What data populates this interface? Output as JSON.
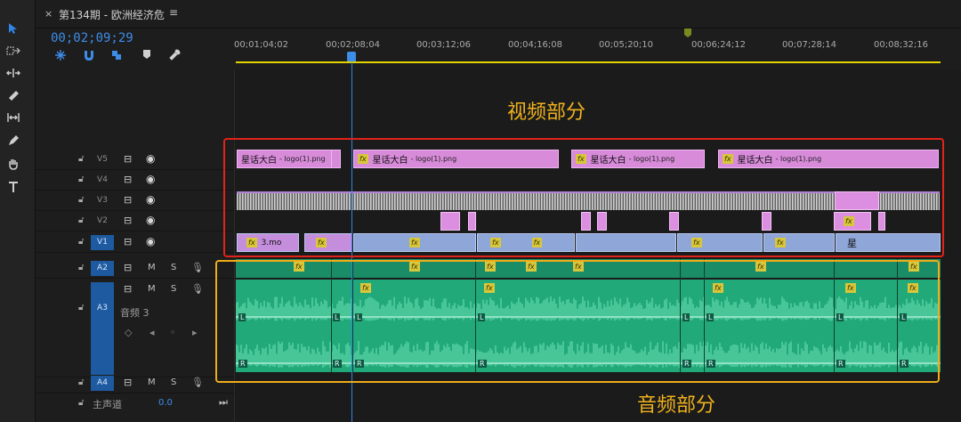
{
  "panel": {
    "close_glyph": "×",
    "sequence_title": "第134期 - 欧洲经济危",
    "menu_glyph": "≡",
    "timecode": "00;02;09;29"
  },
  "ruler": {
    "ticks": [
      "00;01;04;02",
      "00;02;08;04",
      "00;03;12;06",
      "00;04;16;08",
      "00;05;20;10",
      "00;06;24;12",
      "00;07;28;14",
      "00;08;32;16"
    ]
  },
  "annotations": {
    "video": "视频部分",
    "audio": "音频部分"
  },
  "tracks": {
    "video": [
      {
        "name": "V5",
        "target": false
      },
      {
        "name": "V4",
        "target": false
      },
      {
        "name": "V3",
        "target": false
      },
      {
        "name": "V2",
        "target": false
      },
      {
        "name": "V1",
        "target": true
      }
    ],
    "audio": [
      {
        "name": "A2",
        "target": true
      },
      {
        "name": "A3",
        "target": true,
        "label": "音频 3"
      },
      {
        "name": "A4",
        "target": true
      }
    ],
    "m_label": "M",
    "s_label": "S",
    "master_label": "主声道",
    "master_value": "0.0"
  },
  "clips": {
    "v5": [
      {
        "title": "星话大白",
        "file": " - logo(1).png",
        "fx": false
      },
      {
        "title": "星话大白",
        "file": " - logo(1).png",
        "fx": true
      },
      {
        "title": "星话大白",
        "file": " - logo(1).png",
        "fx": true
      },
      {
        "title": "星话大白",
        "file": " - logo(1).png",
        "fx": true
      }
    ],
    "v1_first": "3.mo",
    "v1_last": "星",
    "fx_label": "fx",
    "channel_l": "L",
    "channel_r": "R"
  },
  "icons": {
    "tools": [
      "selection-icon",
      "track-select-icon",
      "ripple-edit-icon",
      "razor-icon",
      "slip-icon",
      "pen-icon",
      "hand-icon",
      "type-icon"
    ],
    "accent": "#2f86e8",
    "clip_pink": "#d78bd9",
    "audio_green": "#22a97a"
  }
}
